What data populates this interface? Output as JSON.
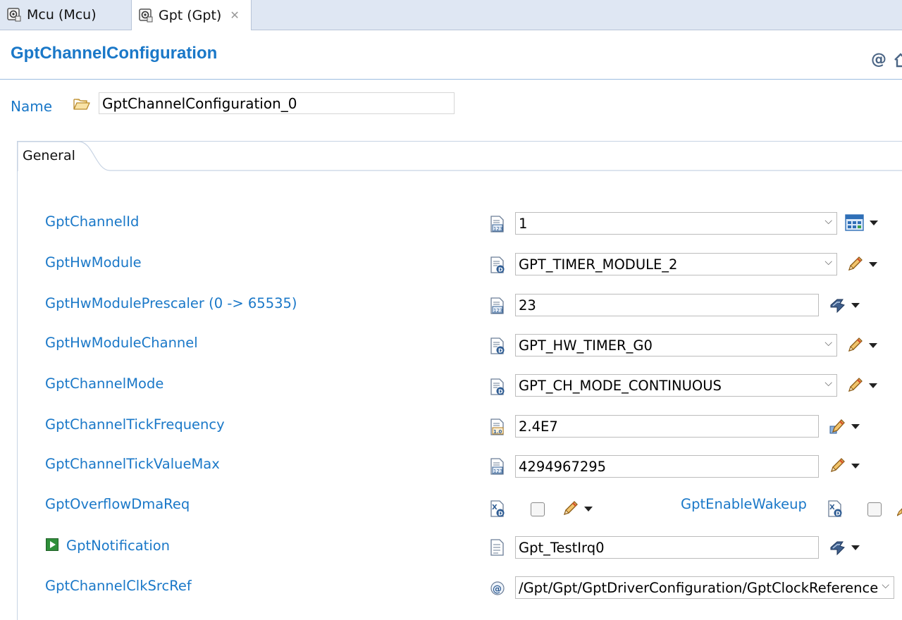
{
  "tabs": [
    {
      "label": "Mcu (Mcu)",
      "active": false
    },
    {
      "label": "Gpt (Gpt)",
      "active": true,
      "closable": true
    }
  ],
  "form": {
    "title": "GptChannelConfiguration",
    "name_label": "Name",
    "name_value": "GptChannelConfiguration_0",
    "header_icons": [
      "at-sign-icon",
      "home-icon"
    ]
  },
  "section_tab": "General",
  "params": [
    {
      "label": "GptChannelId",
      "value": "1",
      "kind": "combo",
      "type_icon": "integer-param-icon",
      "action_icon": "calculator-icon"
    },
    {
      "label": "GptHwModule",
      "value": "GPT_TIMER_MODULE_2",
      "kind": "combo",
      "type_icon": "enum-param-icon",
      "action_icon": "pencil-icon"
    },
    {
      "label": "GptHwModulePrescaler (0 -> 65535)",
      "value": "23",
      "kind": "text",
      "type_icon": "integer-param-icon",
      "action_icon": "calculated-icon"
    },
    {
      "label": "GptHwModuleChannel",
      "value": "GPT_HW_TIMER_G0",
      "kind": "combo",
      "type_icon": "enum-param-icon",
      "action_icon": "pencil-icon"
    },
    {
      "label": "GptChannelMode",
      "value": "GPT_CH_MODE_CONTINUOUS",
      "kind": "combo",
      "type_icon": "enum-param-icon",
      "action_icon": "pencil-icon"
    },
    {
      "label": "GptChannelTickFrequency",
      "value": "2.4E7",
      "kind": "text",
      "type_icon": "float-param-icon",
      "action_icon": "linked-pencil-icon"
    },
    {
      "label": "GptChannelTickValueMax",
      "value": "4294967295",
      "kind": "text",
      "type_icon": "integer-param-icon",
      "action_icon": "pencil-icon"
    },
    {
      "label": "GptOverflowDmaReq",
      "value": "",
      "kind": "checkbox",
      "type_icon": "boolean-param-icon",
      "action_icon": "pencil-icon"
    },
    {
      "label": "GptNotification",
      "value": "Gpt_TestIrq0",
      "kind": "text",
      "type_icon": "function-param-icon",
      "action_icon": "calculated-icon"
    },
    {
      "label": "GptChannelClkSrcRef",
      "value": "/Gpt/Gpt/GptDriverConfiguration/GptClockReference",
      "kind": "combo",
      "type_icon": "reference-param-icon",
      "action_icon": ""
    }
  ],
  "wakeup": {
    "label": "GptEnableWakeup",
    "checked": false
  },
  "overflow_dma": {
    "checked": false
  },
  "colors": {
    "link_blue": "#1a78c8",
    "tabbar_bg": "#dfe7f3"
  }
}
